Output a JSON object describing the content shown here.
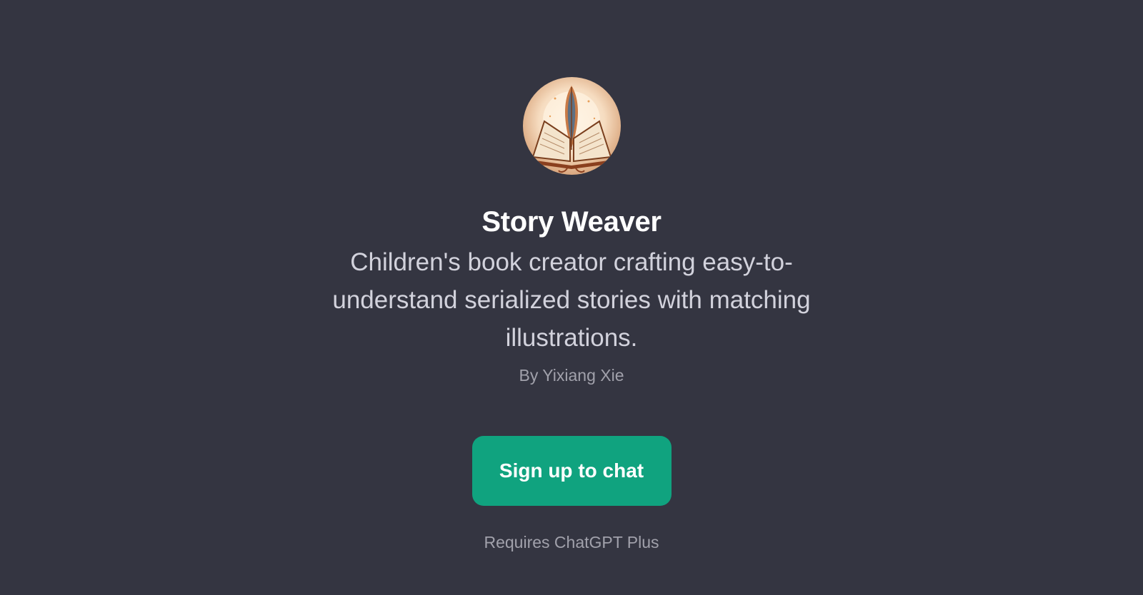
{
  "gpt": {
    "avatar_icon": "open-book-with-feather-quill-icon",
    "title": "Story Weaver",
    "description": "Children's book creator crafting easy-to-understand serialized stories with matching illustrations.",
    "author": "By Yixiang Xie"
  },
  "actions": {
    "signup_label": "Sign up to chat"
  },
  "footer": {
    "requirement": "Requires ChatGPT Plus"
  },
  "colors": {
    "background": "#343541",
    "accent": "#10a37f",
    "title": "#ffffff",
    "description": "#d2d2dc",
    "muted": "#a1a1ab"
  }
}
